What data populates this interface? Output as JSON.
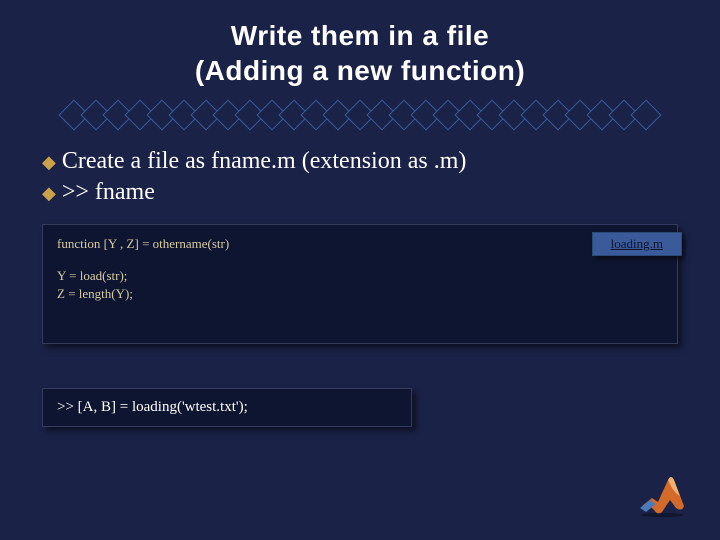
{
  "title": {
    "line1": "Write them in a file",
    "line2": "(Adding a new function)"
  },
  "bullets": {
    "item1": "Create a file as fname.m (extension as .m)",
    "item2": ">> fname"
  },
  "code": {
    "line1": "function [Y , Z] = othername(str)",
    "line2": "Y = load(str);",
    "line3": "Z = length(Y);"
  },
  "file_tab": "loading.m",
  "command": ">>  [A, B] = loading('wtest.txt');",
  "icons": {
    "bullet": "bullet-diamond",
    "logo": "matlab-logo"
  }
}
